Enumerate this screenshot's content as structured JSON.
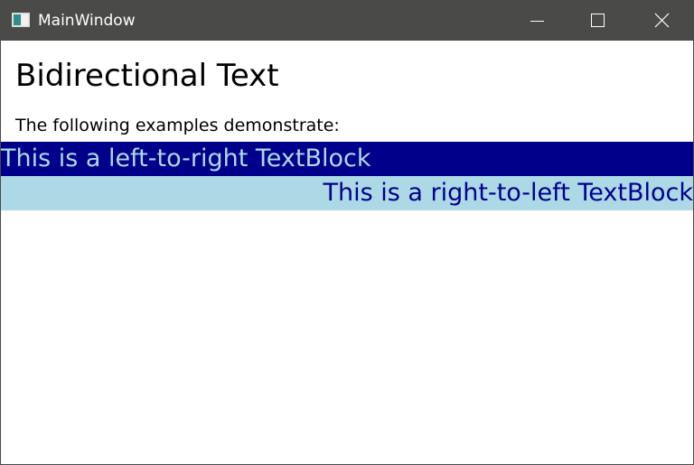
{
  "window": {
    "title": "MainWindow",
    "icon": "window-app-icon"
  },
  "controls": {
    "minimize_icon": "minimize-icon",
    "maximize_icon": "maximize-icon",
    "close_icon": "close-icon"
  },
  "content": {
    "heading": "Bidirectional Text",
    "subtitle": "The following examples demonstrate:",
    "ltr_text": "This is a left-to-right TextBlock",
    "rtl_text": "This is a right-to-left TextBlock"
  },
  "colors": {
    "titlebar": "#4a4a48",
    "ltr_background": "#00008b",
    "ltr_foreground": "#add8e6",
    "rtl_background": "#add8e6",
    "rtl_foreground": "#00008b"
  }
}
